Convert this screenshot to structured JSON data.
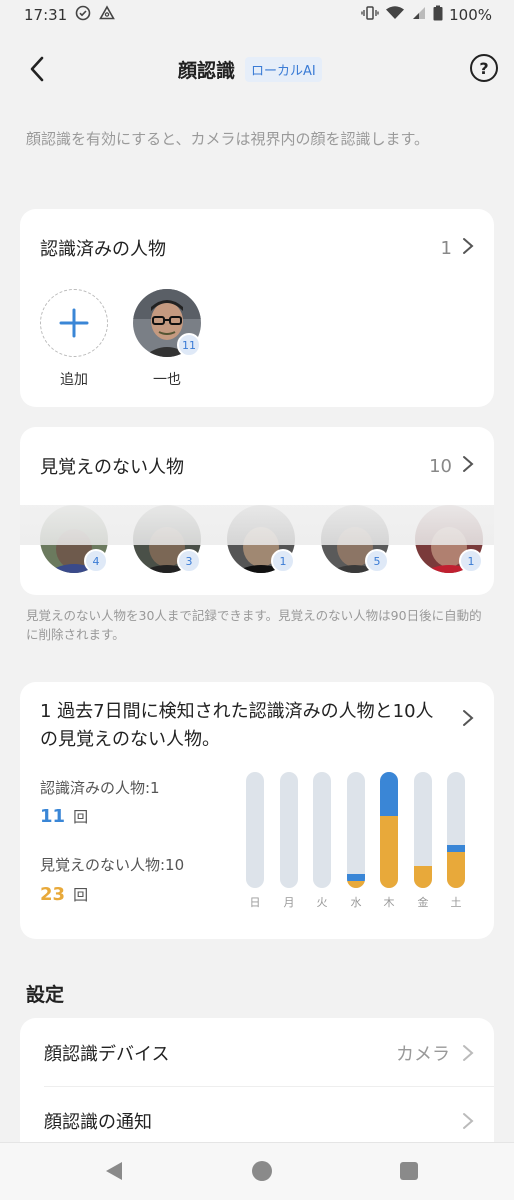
{
  "status": {
    "time": "17:31",
    "battery": "100%"
  },
  "header": {
    "title": "顔認識",
    "badge": "ローカルAI"
  },
  "description": "顔認識を有効にすると、カメラは視界内の顔を認識します。",
  "known": {
    "title": "認識済みの人物",
    "count": "1",
    "add_label": "追加",
    "persons": [
      {
        "name": "一也",
        "badge": "11"
      }
    ]
  },
  "unknown": {
    "title": "見覚えのない人物",
    "count": "10",
    "faces": [
      {
        "badge": "4"
      },
      {
        "badge": "3"
      },
      {
        "badge": "1"
      },
      {
        "badge": "5"
      },
      {
        "badge": "1"
      }
    ],
    "note": "見覚えのない人物を30人まで記録できます。見覚えのない人物は90日後に自動的に削除されます。"
  },
  "stats": {
    "title": "1 過去7日間に検知された認識済みの人物と10人の見覚えのない人物。",
    "known_label": "認識済みの人物:1",
    "known_value": "11",
    "known_unit": "回",
    "unknown_label": "見覚えのない人物:10",
    "unknown_value": "23",
    "unknown_unit": "回",
    "colors": {
      "known": "#3a86d6",
      "unknown": "#e8a93a",
      "track": "#dde3ea"
    }
  },
  "chart_data": {
    "type": "bar",
    "categories": [
      "日",
      "月",
      "火",
      "水",
      "木",
      "金",
      "土"
    ],
    "series": [
      {
        "name": "認識済みの人物",
        "values": [
          0,
          0,
          0,
          1,
          6,
          0,
          1
        ]
      },
      {
        "name": "見覚えのない人物",
        "values": [
          0,
          0,
          0,
          1,
          10,
          3,
          5
        ]
      }
    ],
    "ylim": [
      0,
      16
    ]
  },
  "settings": {
    "title": "設定",
    "rows": [
      {
        "label": "顔認識デバイス",
        "value": "カメラ"
      },
      {
        "label": "顔認識の通知",
        "value": ""
      }
    ]
  }
}
